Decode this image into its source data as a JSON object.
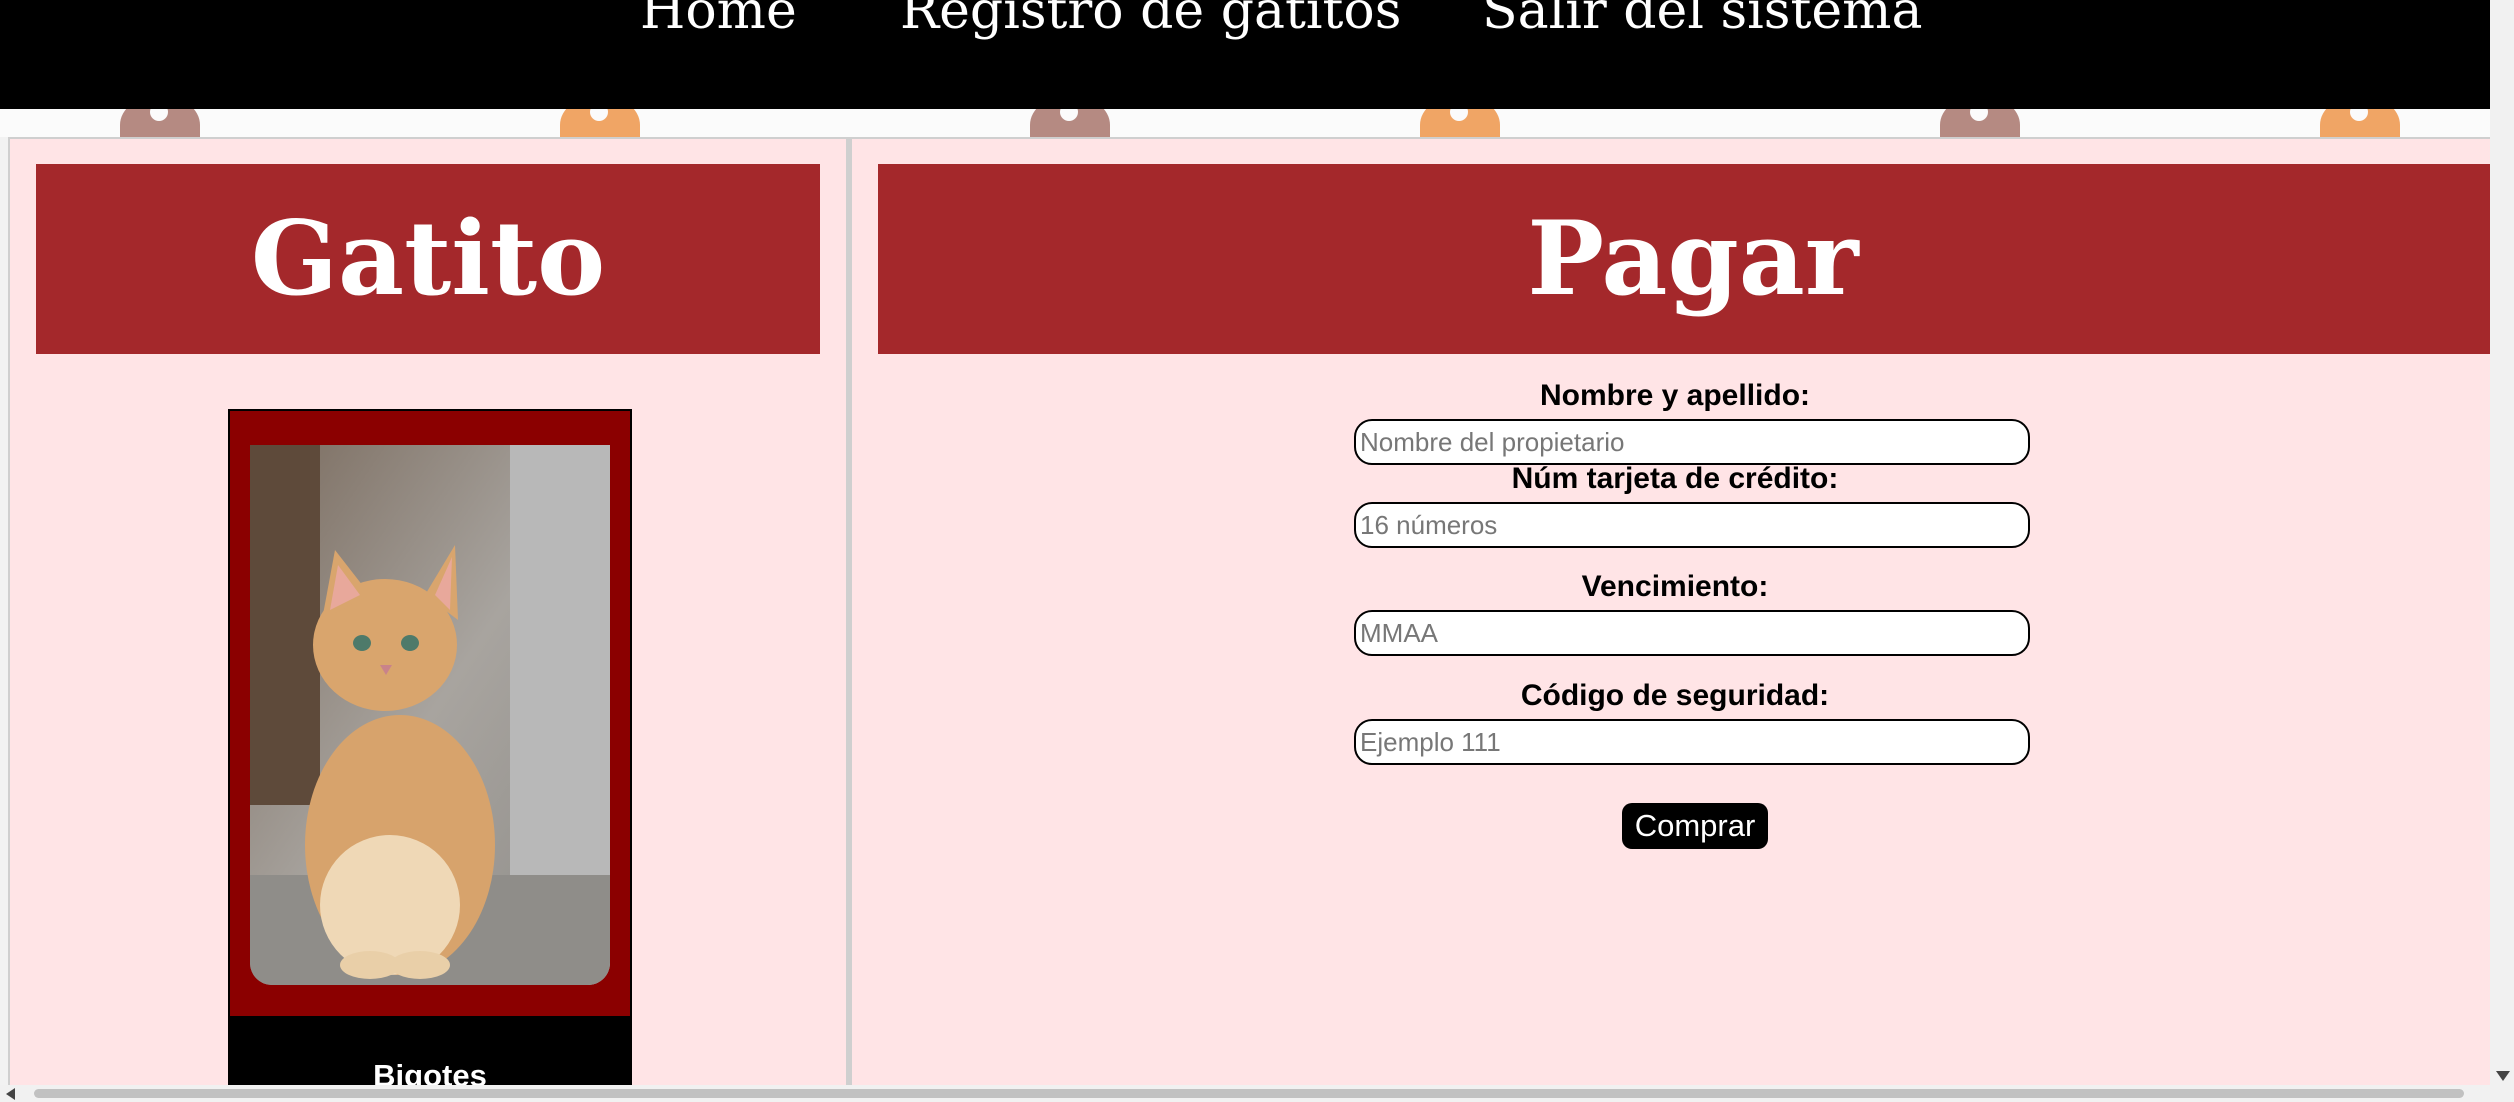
{
  "nav": {
    "home": "Home",
    "registro": "Registro de gatitos",
    "salir": "Salir del sistema"
  },
  "gatito_panel": {
    "title": "Gatito",
    "cat_name": "Bigotes"
  },
  "pagar_panel": {
    "title": "Pagar",
    "form": {
      "nombre_label": "Nombre y apellido:",
      "nombre_placeholder": "Nombre del propietario",
      "tarjeta_label": "Núm tarjeta de crédito:",
      "tarjeta_placeholder": "16 números",
      "vencimiento_label": "Vencimiento:",
      "vencimiento_placeholder": "MMAA",
      "codigo_label": "Código de seguridad:",
      "codigo_placeholder": "Ejemplo 111",
      "submit_label": "Comprar"
    }
  },
  "colors": {
    "nav_bg": "#000000",
    "band_bg": "#a4282b",
    "panel_bg": "#ffe4e6",
    "card_bg": "#8b0000"
  },
  "icons": [
    "cat-photo",
    "paw-pattern"
  ]
}
